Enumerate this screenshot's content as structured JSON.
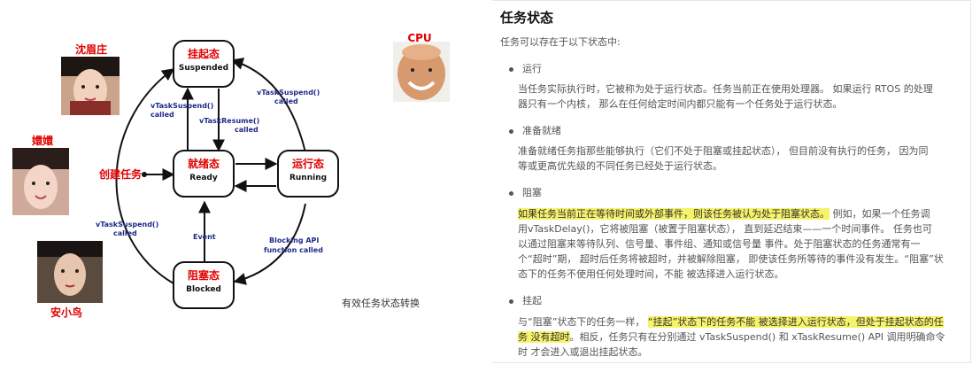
{
  "diagram": {
    "states": {
      "suspended": {
        "cn": "挂起态",
        "en": "Suspended"
      },
      "ready": {
        "cn": "就绪态",
        "en": "Ready"
      },
      "running": {
        "cn": "运行态",
        "en": "Running"
      },
      "blocked": {
        "cn": "阻塞态",
        "en": "Blocked"
      }
    },
    "labels": {
      "suspend_left_top": "vTaskSuspend()",
      "suspend_left_top2": "called",
      "resume": "vTaskResume()",
      "resume2": "called",
      "suspend_right": "vTaskSuspend()",
      "suspend_right2": "called",
      "suspend_left": "vTaskSuspend()",
      "suspend_left2": "called",
      "event": "Event",
      "blocking": "Blocking API",
      "blocking2": "function called",
      "create": "创建任务"
    },
    "people": {
      "p1": "沈眉庄",
      "p2": "嬛嬛",
      "p3": "安小鸟",
      "p4": "CPU"
    },
    "caption": "有效任务状态转换"
  },
  "doc": {
    "title": "任务状态",
    "intro": "任务可以存在于以下状态中:",
    "s1_title": "运行",
    "s1_p1": "当任务实际执行时，它被称为处于运行状态。任务当前正在使用处理器。 如果运行 RTOS 的处理",
    "s1_p2": "器只有一个内核， 那么在任何给定时间内都只能有一个任务处于运行状态。",
    "s2_title": "准备就绪",
    "s2_p1": "准备就绪任务指那些能够执行（它们不处于阻塞或挂起状态）， 但目前没有执行的任务， 因为同",
    "s2_p2": "等或更高优先级的不同任务已经处于运行状态。",
    "s3_title": "阻塞",
    "s3_hl": "如果任务当前正在等待时间或外部事件，则该任务被认为处于阻塞状态。",
    "s3_p1_rest": " 例如，如果一个任务调",
    "s3_p2": "用vTaskDelay()，它将被阻塞（被置于阻塞状态）， 直到延迟结束——一个时间事件。 任务也可",
    "s3_p3": "以通过阻塞来等待队列、信号量、事件组、通知或信号量 事件。处于阻塞状态的任务通常有一",
    "s3_p4": "个“超时”期， 超时后任务将被超时，并被解除阻塞， 即使该任务所等待的事件没有发生。“阻塞”状",
    "s3_p5": "态下的任务不使用任何处理时间，不能 被选择进入运行状态。",
    "s4_title": "挂起",
    "s4_p1_a": "与“阻塞”状态下的任务一样， ",
    "s4_p1_hl": "“挂起”状态下的任务不能 被选择进入运行状态，但处于挂起状态的任",
    "s4_p2_hl": "务 没有超时",
    "s4_p2_rest": "。相反，任务只有在分别通过 vTaskSuspend() 和 xTaskResume() API 调用明确命令",
    "s4_p3": "时 才会进入或退出挂起状态。"
  }
}
